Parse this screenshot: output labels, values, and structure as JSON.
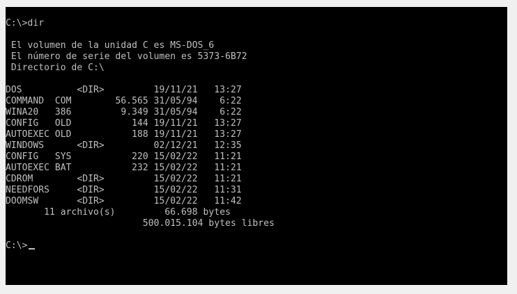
{
  "terminal": {
    "lines": [
      "C:\\>dir",
      "",
      " El volumen de la unidad C es MS-DOS_6",
      " El número de serie del volumen es 5373-6B72",
      " Directorio de C:\\",
      "",
      "DOS          <DIR>         19/11/21   13:27",
      "COMMAND  COM        56.565 31/05/94    6:22",
      "WINA20   386         9.349 31/05/94    6:22",
      "CONFIG   OLD           144 19/11/21   13:27",
      "AUTOEXEC OLD           188 19/11/21   13:27",
      "WINDOWS      <DIR>         02/12/21   12:35",
      "CONFIG   SYS           220 15/02/22   11:21",
      "AUTOEXEC BAT           232 15/02/22   11:21",
      "CDROM        <DIR>         15/02/22   11:21",
      "NEEDFORS     <DIR>         15/02/22   11:31",
      "DOOMSW       <DIR>         15/02/22   11:42",
      "       11 archivo(s)         66.698 bytes",
      "                         500.015.104 bytes libres",
      "",
      "C:\\>"
    ]
  },
  "colors": {
    "screen_background": "#000000",
    "text": "#c0c0c0",
    "outer_background": "#f0f0f0"
  }
}
